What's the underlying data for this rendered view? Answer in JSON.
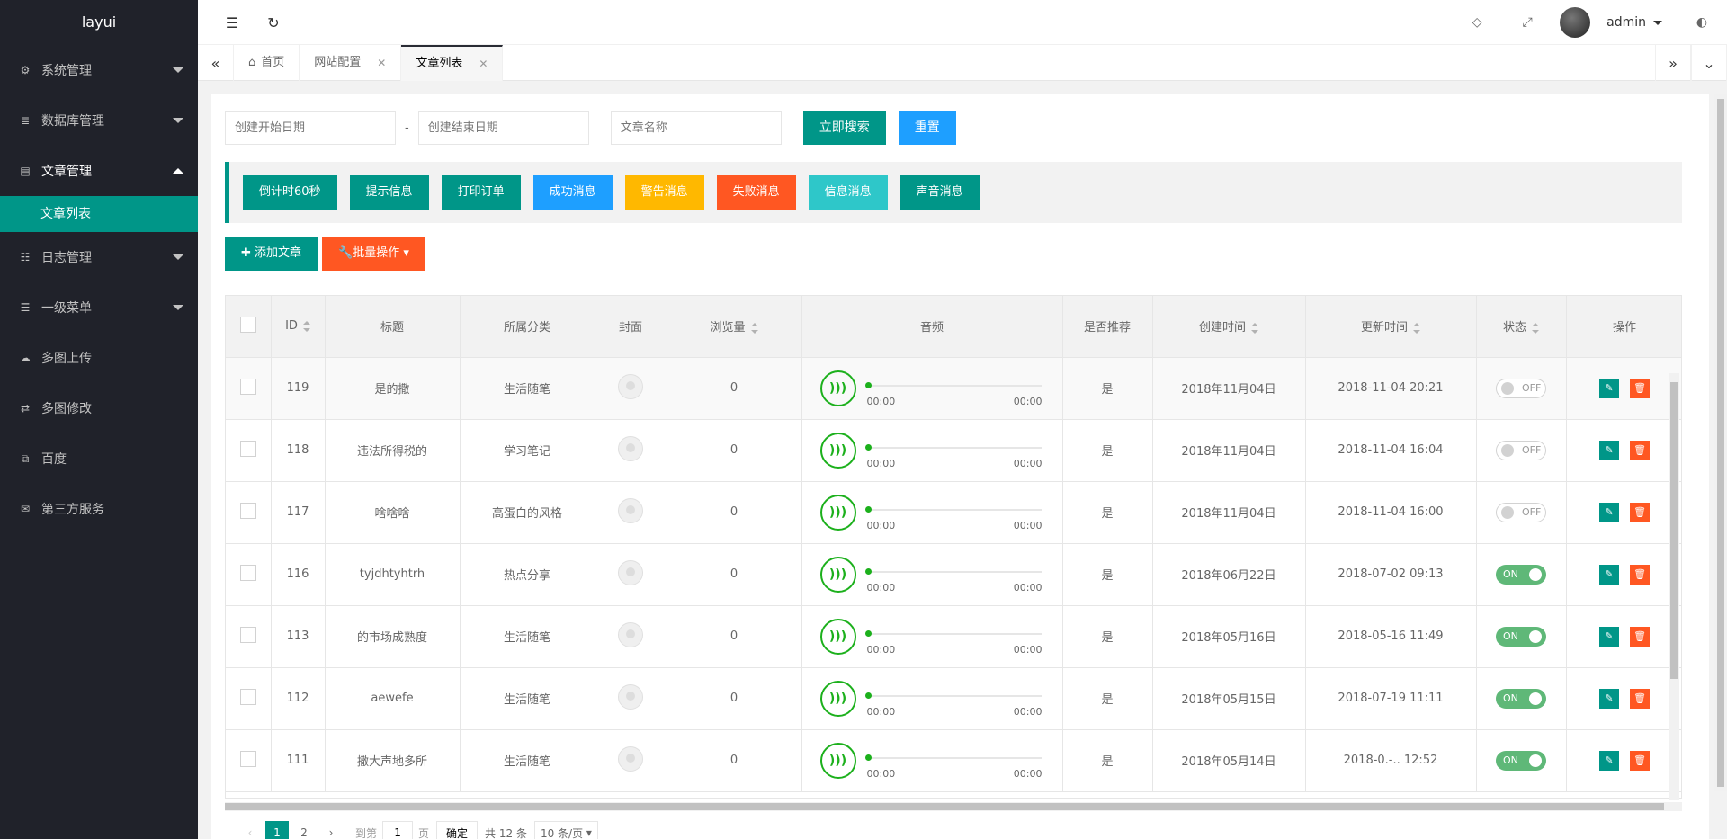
{
  "brand": "layui",
  "colors": {
    "primary": "#009688",
    "sidebar_bg": "#20222a",
    "blue": "#1e9fff",
    "orange": "#ff5722",
    "yellow": "#ffb800",
    "cyan": "#2ec7c9",
    "switch_on": "#5fb878"
  },
  "sidebar": {
    "items": [
      {
        "label": "系统管理",
        "icon": "gear-icon"
      },
      {
        "label": "数据库管理",
        "icon": "database-icon"
      },
      {
        "label": "文章管理",
        "icon": "file-icon",
        "open": true,
        "sub": [
          "文章列表"
        ]
      },
      {
        "label": "日志管理",
        "icon": "log-icon"
      },
      {
        "label": "一级菜单",
        "icon": "list-icon"
      },
      {
        "label": "多图上传",
        "icon": "cloud-upload-icon"
      },
      {
        "label": "多图修改",
        "icon": "exchange-icon"
      },
      {
        "label": "百度",
        "icon": "external-link-icon"
      },
      {
        "label": "第三方服务",
        "icon": "envelope-icon"
      }
    ]
  },
  "header": {
    "username": "admin"
  },
  "tabs": [
    {
      "label": "首页"
    },
    {
      "label": "网站配置"
    },
    {
      "label": "文章列表"
    }
  ],
  "search": {
    "start_placeholder": "创建开始日期",
    "dash": "-",
    "end_placeholder": "创建结束日期",
    "name_placeholder": "文章名称",
    "search_label": "立即搜索",
    "reset_label": "重置"
  },
  "messages": [
    "倒计时60秒",
    "提示信息",
    "打印订单",
    "成功消息",
    "警告消息",
    "失败消息",
    "信息消息",
    "声音消息"
  ],
  "actions": {
    "add_label": "添加文章",
    "batch_label": "批量操作"
  },
  "table": {
    "headers": [
      "ID",
      "标题",
      "所属分类",
      "封面",
      "浏览量",
      "音频",
      "是否推荐",
      "创建时间",
      "更新时间",
      "状态",
      "操作"
    ],
    "audio_time": "00:00",
    "rows": [
      {
        "id": "119",
        "title": "是的撒",
        "category": "生活随笔",
        "views": "0",
        "recommend": "是",
        "created": "2018年11月04日",
        "updated": "2018-11-04 20:21",
        "status": "OFF"
      },
      {
        "id": "118",
        "title": "违法所得税的",
        "category": "学习笔记",
        "views": "0",
        "recommend": "是",
        "created": "2018年11月04日",
        "updated": "2018-11-04 16:04",
        "status": "OFF"
      },
      {
        "id": "117",
        "title": "啥啥啥",
        "category": "高蛋白的风格",
        "views": "0",
        "recommend": "是",
        "created": "2018年11月04日",
        "updated": "2018-11-04 16:00",
        "status": "OFF"
      },
      {
        "id": "116",
        "title": "tyjdhtyhtrh",
        "category": "热点分享",
        "views": "0",
        "recommend": "是",
        "created": "2018年06月22日",
        "updated": "2018-07-02 09:13",
        "status": "ON"
      },
      {
        "id": "113",
        "title": "的市场成熟度",
        "category": "生活随笔",
        "views": "0",
        "recommend": "是",
        "created": "2018年05月16日",
        "updated": "2018-05-16 11:49",
        "status": "ON"
      },
      {
        "id": "112",
        "title": "aewefe",
        "category": "生活随笔",
        "views": "0",
        "recommend": "是",
        "created": "2018年05月15日",
        "updated": "2018-07-19 11:11",
        "status": "ON"
      },
      {
        "id": "111",
        "title": "撒大声地多所",
        "category": "生活随笔",
        "views": "0",
        "recommend": "是",
        "created": "2018年05月14日",
        "updated": "2018-0.-.. 12:52",
        "status": "ON"
      }
    ]
  },
  "pager": {
    "pages": [
      "1",
      "2"
    ],
    "goto_label": "到第",
    "page_value": "1",
    "page_unit": "页",
    "confirm_label": "确定",
    "total": "共 12 条",
    "per_page": "10 条/页"
  }
}
